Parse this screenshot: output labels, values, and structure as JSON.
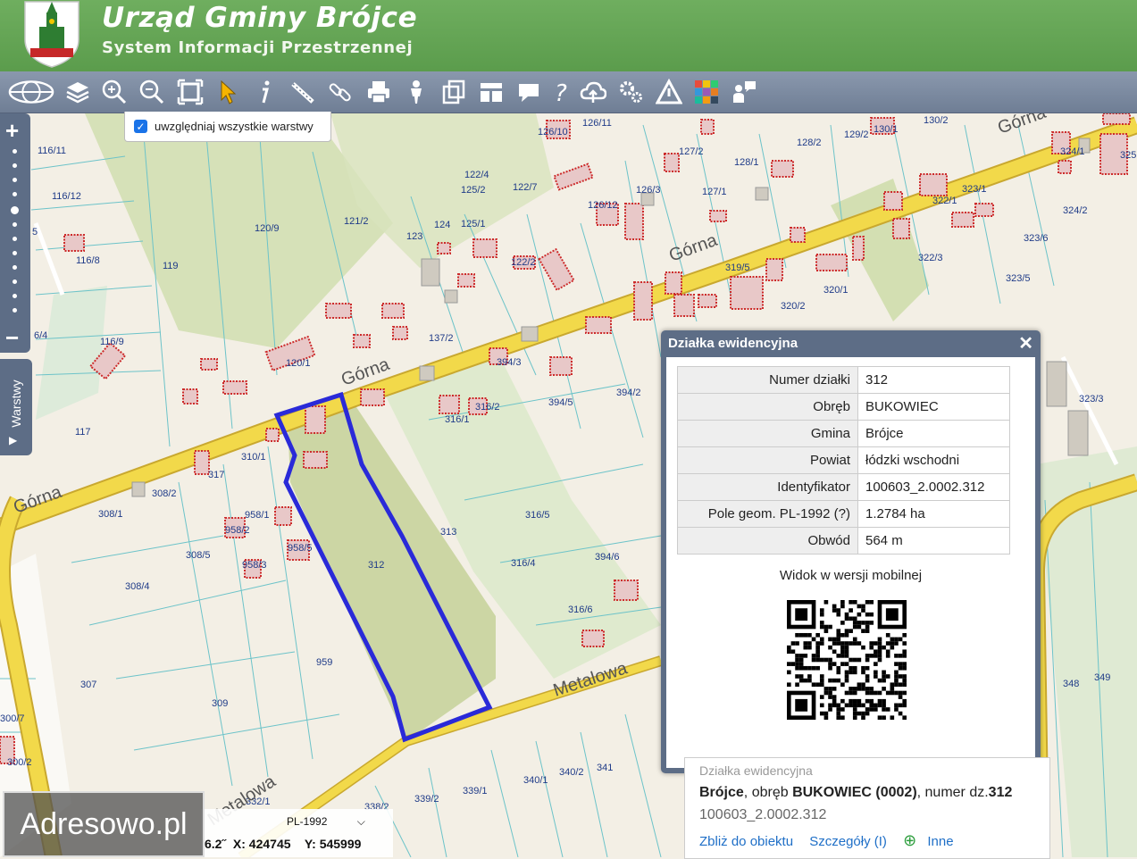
{
  "header": {
    "title": "Urząd Gminy Brójce",
    "subtitle": "System Informacji Przestrzennej"
  },
  "toolbar": {
    "tools": [
      "globe-icon",
      "layers-icon",
      "zoom-in-icon",
      "zoom-out-icon",
      "zoom-extent-icon",
      "select-arrow-icon",
      "info-icon",
      "measure-icon",
      "link-icon",
      "print-icon",
      "person-icon",
      "copy-icon",
      "layout-icon",
      "comment-icon",
      "help-icon",
      "cloud-upload-icon",
      "settings-icon",
      "warning-icon",
      "palette-icon",
      "user-comment-icon"
    ]
  },
  "layer_option": {
    "label": "uwzględniaj wszystkie warstwy",
    "checked": true
  },
  "side_tab": {
    "label": "Warstwy"
  },
  "map": {
    "parcels": [
      "116/11",
      "116/12",
      "116/8",
      "119",
      "120/9",
      "121/2",
      "122/4",
      "125/2",
      "122/7",
      "123",
      "124",
      "125/1",
      "122/2",
      "126/10",
      "126/11",
      "126/3",
      "126/12",
      "127/2",
      "127/1",
      "128/1",
      "128/2",
      "129/2",
      "130/1",
      "130/2",
      "324/1",
      "325",
      "323/1",
      "322/1",
      "324/2",
      "323/6",
      "322/3",
      "323/5",
      "319/5",
      "320/1",
      "320/2",
      "116/9",
      "120/1",
      "137/2",
      "394/3",
      "394/2",
      "394/5",
      "316/2",
      "316/1",
      "117",
      "310/1",
      "317",
      "308/2",
      "308/1",
      "958/1",
      "958/2",
      "958/5",
      "958/3",
      "308/5",
      "308/4",
      "313",
      "312",
      "316/5",
      "316/4",
      "394/6",
      "316/6",
      "959",
      "307",
      "309",
      "300/7",
      "300/2",
      "339/2",
      "339/1",
      "340/1",
      "340/2",
      "341",
      "338/2",
      "332/1",
      "323/3",
      "348",
      "349",
      "6/4",
      "5"
    ],
    "streets": [
      "Górna",
      "Górna",
      "Górna",
      "Górna",
      "Metalowa",
      "Metalowa"
    ]
  },
  "popup": {
    "title": "Działka ewidencyjna",
    "close": "✕",
    "rows": [
      {
        "label": "Numer działki",
        "value": "312"
      },
      {
        "label": "Obręb",
        "value": "BUKOWIEC"
      },
      {
        "label": "Gmina",
        "value": "Brójce"
      },
      {
        "label": "Powiat",
        "value": "łódzki wschodni"
      },
      {
        "label": "Identyfikator",
        "value": "100603_2.0002.312"
      },
      {
        "label": "Pole geom. PL-1992 (?)",
        "value": "1.2784 ha"
      },
      {
        "label": "Obwód",
        "value": "564 m"
      }
    ],
    "mobile_label": "Widok w wersji mobilnej"
  },
  "result": {
    "ghost_title": "Działka ewidencyjna",
    "place": "Brójce",
    "obreb_prefix": ", obręb ",
    "obreb": "BUKOWIEC (0002)",
    "numer_prefix": ", numer dz.",
    "numer": "312",
    "identifier": "100603_2.0002.312",
    "actions": [
      "Zbliż do obiektu",
      "Szczegóły (I)",
      "Inne"
    ]
  },
  "coords": {
    "crs": "PL-1992",
    "scale_fragment": "6.2˝",
    "x_label": "X:",
    "x": "424745",
    "y_label": "Y:",
    "y": "545999"
  },
  "watermark": "Adresowo.pl",
  "colors": {
    "header_green": "#5fa04f",
    "toolbar": "#7585a0",
    "road": "#f2d94a",
    "building_outline": "#cc2a2a",
    "selection": "#2a2ad8",
    "field_green": "#d3dfb5",
    "parcel_line": "#6cc3c9"
  }
}
